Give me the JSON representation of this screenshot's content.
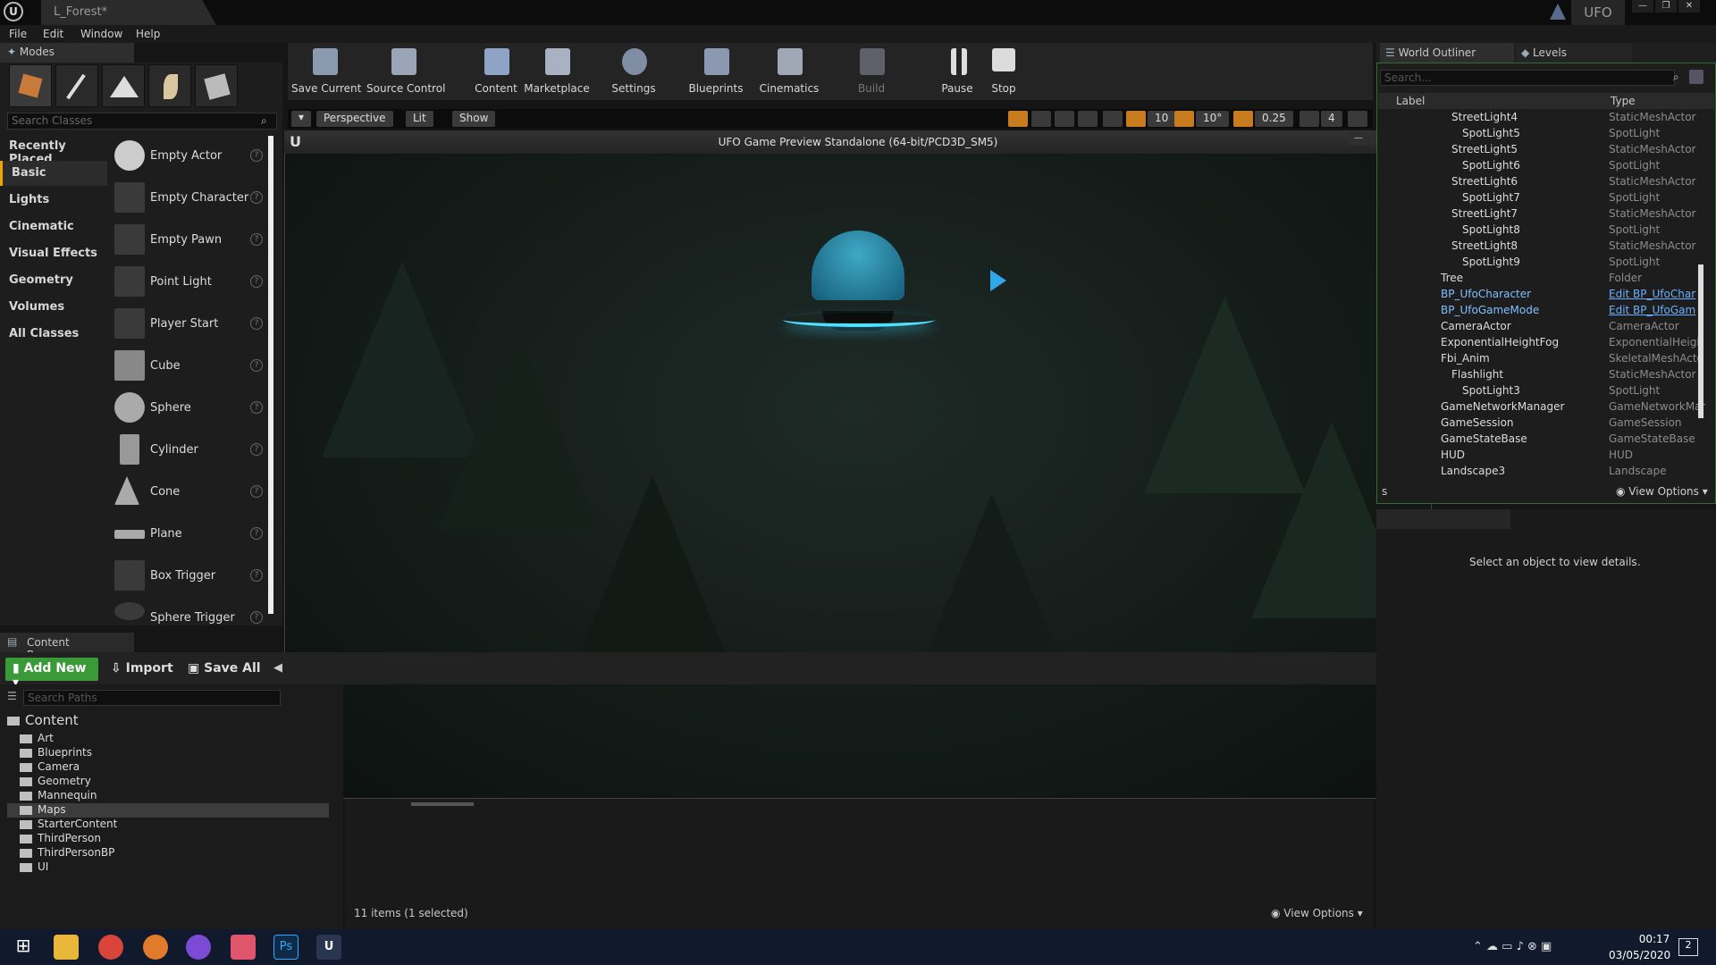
{
  "window": {
    "tab_title": "L_Forest*",
    "project": "UFO"
  },
  "menu": [
    "File",
    "Edit",
    "Window",
    "Help"
  ],
  "modes": {
    "tab_label": "Modes",
    "search_placeholder": "Search Classes",
    "categories": [
      "Recently Placed",
      "Basic",
      "Lights",
      "Cinematic",
      "Visual Effects",
      "Geometry",
      "Volumes",
      "All Classes"
    ],
    "selected_category": "Basic",
    "items": [
      "Empty Actor",
      "Empty Character",
      "Empty Pawn",
      "Point Light",
      "Player Start",
      "Cube",
      "Sphere",
      "Cylinder",
      "Cone",
      "Plane",
      "Box Trigger",
      "Sphere Trigger"
    ]
  },
  "toolbar": {
    "buttons": [
      "Save Current",
      "Source Control",
      "Content",
      "Marketplace",
      "Settings",
      "Blueprints",
      "Cinematics",
      "Build",
      "Pause",
      "Stop"
    ]
  },
  "viewport": {
    "perspective": "Perspective",
    "lit": "Lit",
    "show": "Show",
    "grid_snap": "10",
    "rot_snap": "10°",
    "scale_snap": "0.25",
    "cam_speed": "4"
  },
  "game_window": {
    "title": "UFO Game Preview Standalone (64-bit/PCD3D_SM5)"
  },
  "outliner": {
    "tab_label": "World Outliner",
    "levels_tab": "Levels",
    "search_placeholder": "Search...",
    "col_label": "Label",
    "col_type": "Type",
    "rows": [
      {
        "label": "StreetLight4",
        "type": "StaticMeshActor",
        "indent": 1
      },
      {
        "label": "SpotLight5",
        "type": "SpotLight",
        "indent": 2
      },
      {
        "label": "StreetLight5",
        "type": "StaticMeshActor",
        "indent": 1
      },
      {
        "label": "SpotLight6",
        "type": "SpotLight",
        "indent": 2
      },
      {
        "label": "StreetLight6",
        "type": "StaticMeshActor",
        "indent": 1
      },
      {
        "label": "SpotLight7",
        "type": "SpotLight",
        "indent": 2
      },
      {
        "label": "StreetLight7",
        "type": "StaticMeshActor",
        "indent": 1
      },
      {
        "label": "SpotLight8",
        "type": "SpotLight",
        "indent": 2
      },
      {
        "label": "StreetLight8",
        "type": "StaticMeshActor",
        "indent": 1
      },
      {
        "label": "SpotLight9",
        "type": "SpotLight",
        "indent": 2
      },
      {
        "label": "Tree",
        "type": "Folder",
        "indent": 0
      },
      {
        "label": "BP_UfoCharacter",
        "type": "Edit BP_UfoChar",
        "indent": 0,
        "link": true
      },
      {
        "label": "BP_UfoGameMode",
        "type": "Edit BP_UfoGam",
        "indent": 0,
        "link": true
      },
      {
        "label": "CameraActor",
        "type": "CameraActor",
        "indent": 0
      },
      {
        "label": "ExponentialHeightFog",
        "type": "ExponentialHeigh",
        "indent": 0
      },
      {
        "label": "Fbi_Anim",
        "type": "SkeletalMeshActo",
        "indent": 0
      },
      {
        "label": "Flashlight",
        "type": "StaticMeshActor",
        "indent": 1
      },
      {
        "label": "SpotLight3",
        "type": "SpotLight",
        "indent": 2
      },
      {
        "label": "GameNetworkManager",
        "type": "GameNetworkMar",
        "indent": 0
      },
      {
        "label": "GameSession",
        "type": "GameSession",
        "indent": 0
      },
      {
        "label": "GameStateBase",
        "type": "GameStateBase",
        "indent": 0
      },
      {
        "label": "HUD",
        "type": "HUD",
        "indent": 0
      },
      {
        "label": "Landscape3",
        "type": "Landscape",
        "indent": 0
      }
    ],
    "actors_count": "s",
    "view_options": "View Options"
  },
  "details": {
    "message": "Select an object to view details."
  },
  "content_browser": {
    "tab_label": "Content Browser",
    "add_new": "Add New",
    "import": "Import",
    "save_all": "Save All",
    "search_placeholder": "Search Paths",
    "root": "Content",
    "folders": [
      "Art",
      "Blueprints",
      "Camera",
      "Geometry",
      "Mannequin",
      "Maps",
      "StarterContent",
      "ThirdPerson",
      "ThirdPersonBP",
      "UI"
    ],
    "selected_folder": "Maps",
    "status": "11 items (1 selected)",
    "view_options": "View Options"
  },
  "taskbar": {
    "time": "00:17",
    "date": "03/05/2020",
    "notifications": "2"
  },
  "colors": {
    "accent": "#f0a500",
    "add_new": "#3a9a38",
    "ufo_glow": "#4fe1ff",
    "link": "#6ab0ff"
  }
}
